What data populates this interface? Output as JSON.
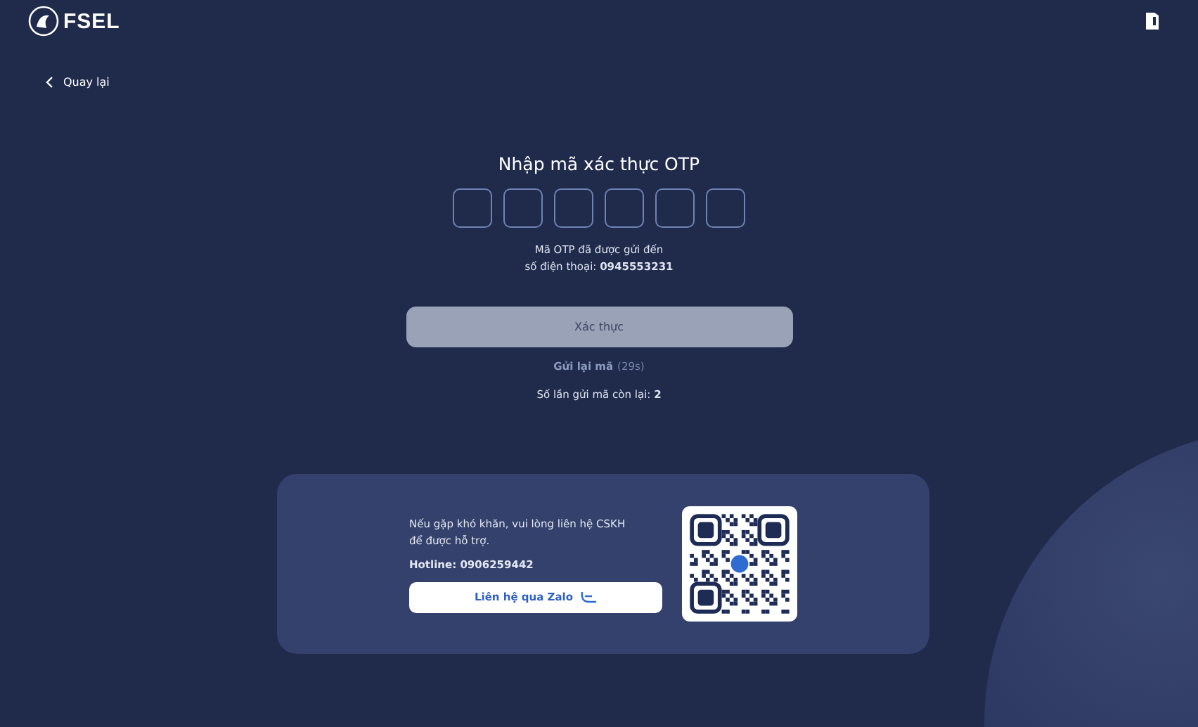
{
  "header": {
    "logo_text": "FSEL"
  },
  "back_link": {
    "label": "Quay lại"
  },
  "otp": {
    "title": "Nhập mã xác thực OTP",
    "digits": [
      {
        "filled": false
      },
      {
        "filled": false
      },
      {
        "filled": false
      },
      {
        "filled": false
      },
      {
        "filled": false
      },
      {
        "filled": false
      }
    ],
    "sent_message": "Mã OTP đã được gửi đến",
    "phone_line": "số điện thoại: **0945553231**",
    "verify_button": {
      "label": "Xác thực",
      "disabled": true
    },
    "resend": {
      "label": "Gửi lại mã",
      "countdown": "(29s)",
      "disabled": true
    },
    "remaining": "Số lần gửi mã còn lại: **2**"
  },
  "support": {
    "message": "Nếu gặp khó khăn, vui lòng liên hệ CSKH để được hỗ trợ.",
    "hotline": "Hotline: 0906259442",
    "zalo_button": "Liên hệ qua Zalo"
  }
}
